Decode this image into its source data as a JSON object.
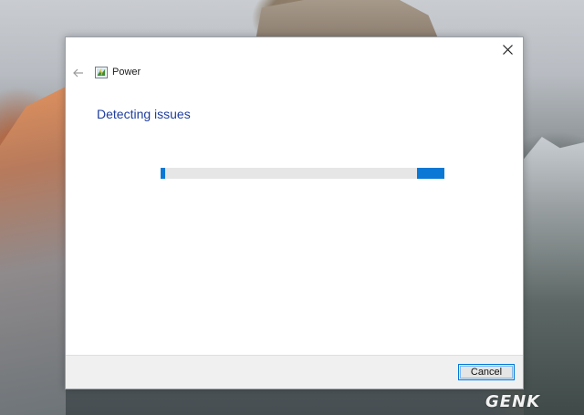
{
  "window": {
    "title": "Power",
    "heading": "Detecting issues",
    "close_icon": "close-icon",
    "back_icon": "back-arrow-icon",
    "app_icon": "power-troubleshooter-icon"
  },
  "progress": {
    "state": "indeterminate",
    "color": "#0a78d4"
  },
  "footer": {
    "cancel_label": "Cancel"
  },
  "watermark": {
    "text": "GENK"
  },
  "colors": {
    "accent": "#0078d7",
    "heading": "#1f3d9e"
  }
}
